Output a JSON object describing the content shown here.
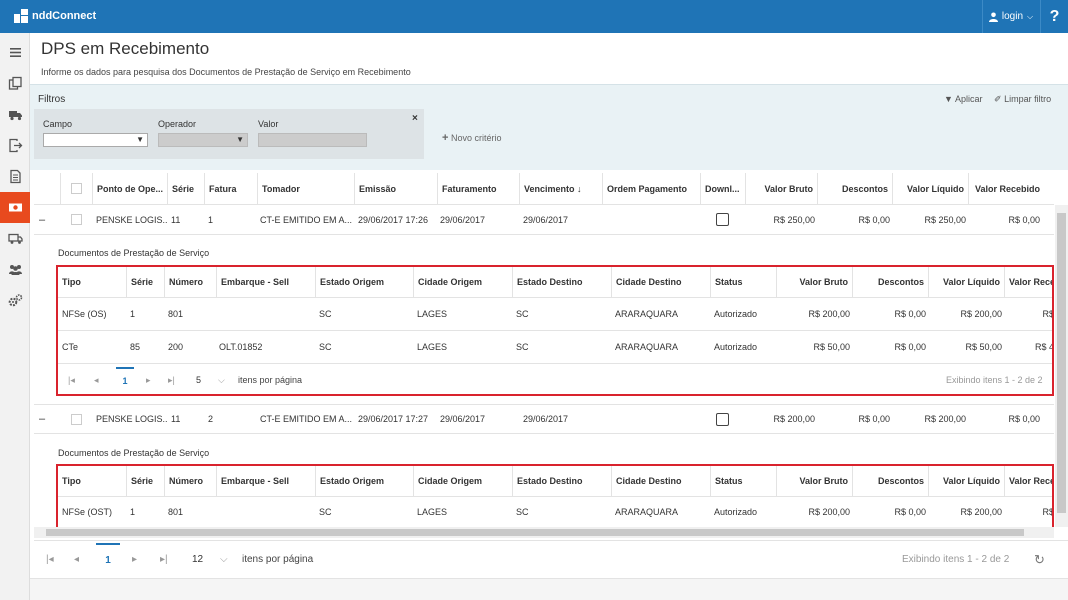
{
  "app": {
    "name": "nddConnect",
    "login_label": "login",
    "help_label": "?"
  },
  "sidebar": {
    "items": [
      {
        "icon": "menu-icon"
      },
      {
        "icon": "documents-icon"
      },
      {
        "icon": "truck-icon"
      },
      {
        "icon": "export-icon"
      },
      {
        "icon": "file-icon"
      },
      {
        "icon": "money-icon"
      },
      {
        "icon": "trailer-icon"
      },
      {
        "icon": "users-icon"
      },
      {
        "icon": "settings-icon"
      }
    ]
  },
  "page": {
    "title": "DPS em Recebimento",
    "subtitle": "Informe os dados para pesquisa dos Documentos de Prestação de Serviço em Recebimento"
  },
  "filters": {
    "title": "Filtros",
    "apply_label": "Aplicar",
    "clear_label": "Limpar filtro",
    "campo_label": "Campo",
    "operador_label": "Operador",
    "valor_label": "Valor",
    "campo_value": "",
    "valor_value": "",
    "new_criterion_label": "Novo critério",
    "close_label": "×"
  },
  "main_table": {
    "columns": {
      "ponto": "Ponto de Ope...",
      "serie": "Série",
      "fatura": "Fatura",
      "tomador": "Tomador",
      "emissao": "Emissão",
      "faturamento": "Faturamento",
      "vencimento": "Vencimento ↓",
      "ordem": "Ordem Pagamento",
      "download": "Downl...",
      "valor_bruto": "Valor Bruto",
      "descontos": "Descontos",
      "valor_liquido": "Valor Líquido",
      "valor_recebido": "Valor Recebido"
    },
    "rows": [
      {
        "expand": "–",
        "ponto": "PENSKE LOGIS...",
        "serie": "11",
        "fatura": "1",
        "tomador": "CT-E EMITIDO EM A...",
        "emissao": "29/06/2017 17:26",
        "faturamento": "29/06/2017",
        "vencimento": "29/06/2017",
        "ordem": "",
        "valor_bruto": "R$ 250,00",
        "descontos": "R$ 0,00",
        "valor_liquido": "R$ 250,00",
        "valor_recebido": "R$ 0,00",
        "detail": {
          "title": "Documentos de Prestação de Serviço",
          "rows": [
            {
              "tipo": "NFSe (OS)",
              "serie": "1",
              "numero": "801",
              "embarque": "",
              "estado_origem": "SC",
              "cidade_origem": "LAGES",
              "estado_destino": "SC",
              "cidade_destino": "ARARAQUARA",
              "status": "Autorizado",
              "valor_bruto": "R$ 200,00",
              "descontos": "R$ 0,00",
              "valor_liquido": "R$ 200,00",
              "valor_recebido": "R$"
            },
            {
              "tipo": "CTe",
              "serie": "85",
              "numero": "200",
              "embarque": "OLT.01852",
              "estado_origem": "SC",
              "cidade_origem": "LAGES",
              "estado_destino": "SC",
              "cidade_destino": "ARARAQUARA",
              "status": "Autorizado",
              "valor_bruto": "R$ 50,00",
              "descontos": "R$ 0,00",
              "valor_liquido": "R$ 50,00",
              "valor_recebido": "R$ 4"
            }
          ],
          "pager": {
            "page": "1",
            "page_size": "5",
            "items_label": "itens por página",
            "summary": "Exibindo itens 1 - 2 de 2"
          }
        }
      },
      {
        "expand": "–",
        "ponto": "PENSKE LOGIS...",
        "serie": "11",
        "fatura": "2",
        "tomador": "CT-E EMITIDO EM A...",
        "emissao": "29/06/2017 17:27",
        "faturamento": "29/06/2017",
        "vencimento": "29/06/2017",
        "ordem": "",
        "valor_bruto": "R$ 200,00",
        "descontos": "R$ 0,00",
        "valor_liquido": "R$ 200,00",
        "valor_recebido": "R$ 0,00",
        "detail": {
          "title": "Documentos de Prestação de Serviço",
          "rows": [
            {
              "tipo": "NFSe (OST)",
              "serie": "1",
              "numero": "801",
              "embarque": "",
              "estado_origem": "SC",
              "cidade_origem": "LAGES",
              "estado_destino": "SC",
              "cidade_destino": "ARARAQUARA",
              "status": "Autorizado",
              "valor_bruto": "R$ 200,00",
              "descontos": "R$ 0,00",
              "valor_liquido": "R$ 200,00",
              "valor_recebido": "R$"
            }
          ]
        }
      }
    ]
  },
  "detail_columns": {
    "tipo": "Tipo",
    "serie": "Série",
    "numero": "Número",
    "embarque": "Embarque - Sell",
    "estado_origem": "Estado Origem",
    "cidade_origem": "Cidade Origem",
    "estado_destino": "Estado Destino",
    "cidade_destino": "Cidade Destino",
    "status": "Status",
    "valor_bruto": "Valor Bruto",
    "descontos": "Descontos",
    "valor_liquido": "Valor Líquido",
    "valor_recebido": "Valor Rece"
  },
  "pager": {
    "page": "1",
    "page_size": "12",
    "items_label": "itens por página",
    "summary": "Exibindo itens 1 - 2 de 2"
  }
}
